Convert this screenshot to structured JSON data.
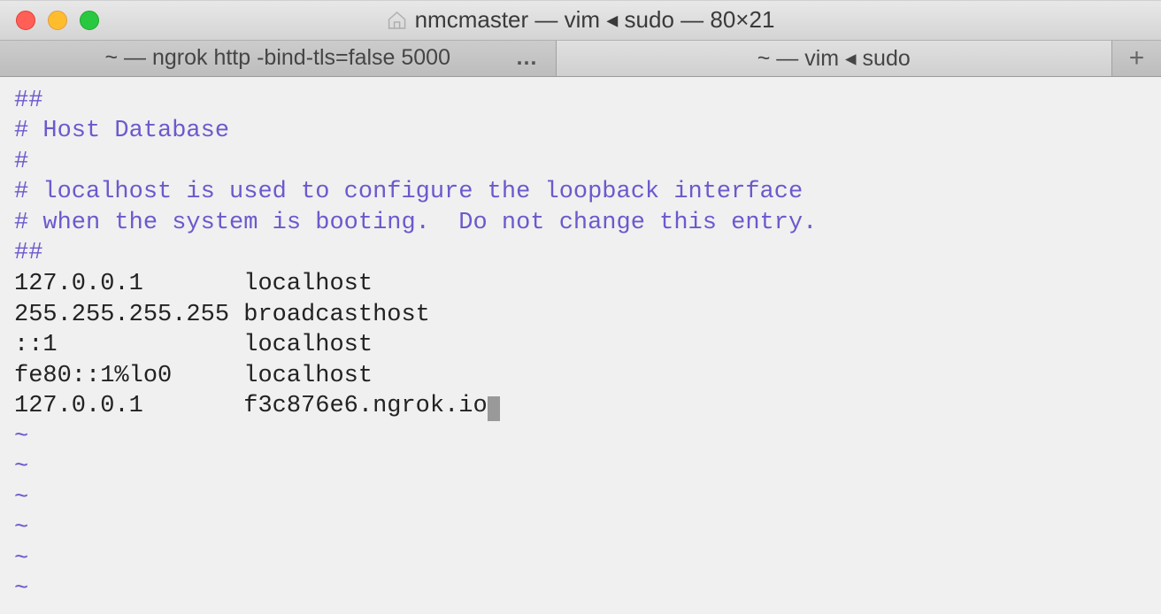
{
  "window": {
    "title": "nmcmaster — vim ◂ sudo — 80×21"
  },
  "tabs": [
    {
      "label": "~ — ngrok http -bind-tls=false 5000",
      "active": false,
      "ellipsis": "…"
    },
    {
      "label": "~ — vim ◂ sudo",
      "active": true,
      "ellipsis": ""
    }
  ],
  "newTabLabel": "+",
  "terminal": {
    "comment1": "##",
    "comment2": "# Host Database",
    "comment3": "#",
    "comment4": "# localhost is used to configure the loopback interface",
    "comment5": "# when the system is booting.  Do not change this entry.",
    "comment6": "##",
    "entries": [
      {
        "ip": "127.0.0.1      ",
        "host": " localhost"
      },
      {
        "ip": "255.255.255.255",
        "host": " broadcasthost"
      },
      {
        "ip": "::1            ",
        "host": " localhost"
      },
      {
        "ip": "fe80::1%lo0    ",
        "host": " localhost"
      },
      {
        "ip": "127.0.0.1      ",
        "host": " f3c876e6.ngrok.io"
      }
    ],
    "tilde": "~"
  }
}
